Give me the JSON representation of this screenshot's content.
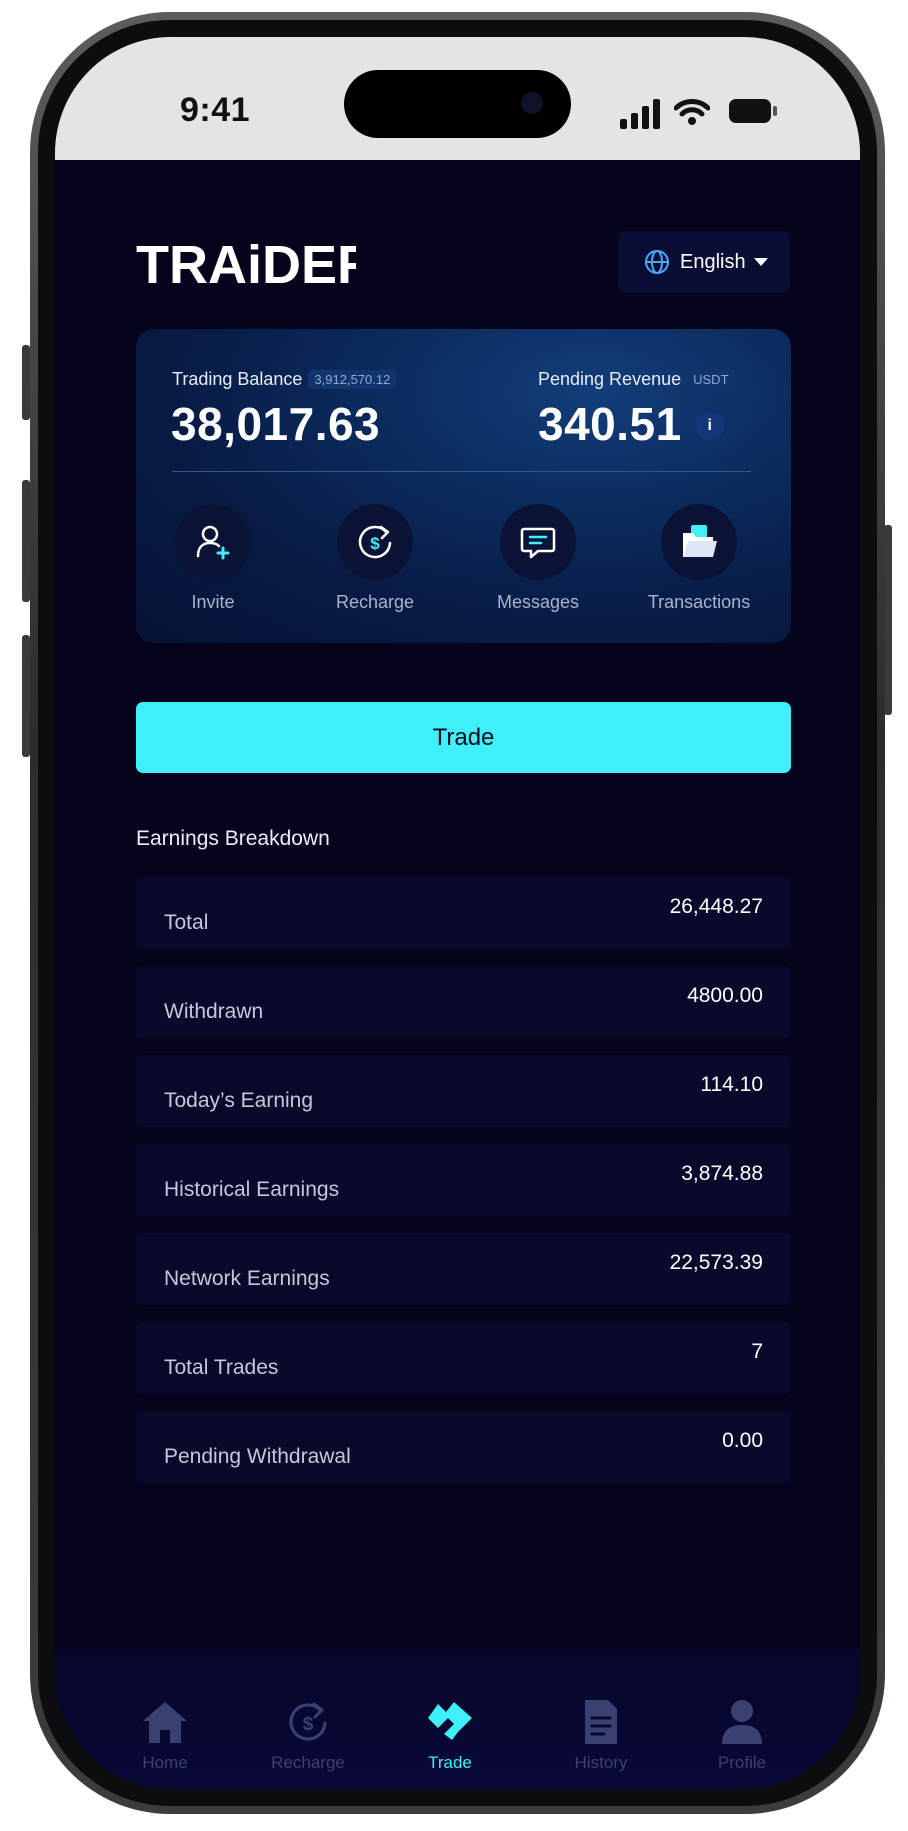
{
  "status_bar": {
    "time": "9:41"
  },
  "header": {
    "brand": "TRAiDER",
    "language": "English"
  },
  "balance_card": {
    "trading_balance_label": "Trading Balance",
    "trading_balance_tag": "3,912,570.12",
    "trading_balance_value": "38,017.63",
    "pending_revenue_label": "Pending Revenue",
    "pending_revenue_tag": "USDT",
    "pending_revenue_value": "340.51",
    "info_glyph": "i",
    "actions": [
      {
        "label": "Invite",
        "icon": "add-user-icon"
      },
      {
        "label": "Recharge",
        "icon": "recharge-icon"
      },
      {
        "label": "Messages",
        "icon": "message-icon"
      },
      {
        "label": "Transactions",
        "icon": "folder-icon"
      }
    ]
  },
  "trade_button": {
    "label": "Trade"
  },
  "earnings": {
    "title": "Earnings Breakdown",
    "rows": [
      {
        "label": "Total",
        "value": "26,448.27"
      },
      {
        "label": "Withdrawn",
        "value": "4800.00"
      },
      {
        "label": "Today’s Earning",
        "value": "114.10"
      },
      {
        "label": "Historical Earnings",
        "value": "3,874.88"
      },
      {
        "label": "Network Earnings",
        "value": "22,573.39"
      },
      {
        "label": "Total Trades",
        "value": "7"
      },
      {
        "label": "Pending Withdrawal",
        "value": "0.00"
      }
    ]
  },
  "tab_bar": {
    "active": "Trade",
    "items": [
      {
        "label": "Home",
        "icon": "home-icon"
      },
      {
        "label": "Recharge",
        "icon": "recharge-icon"
      },
      {
        "label": "Trade",
        "icon": "trade-icon"
      },
      {
        "label": "History",
        "icon": "document-icon"
      },
      {
        "label": "Profile",
        "icon": "user-icon"
      }
    ]
  },
  "colors": {
    "background": "#05041c",
    "accent": "#3ff0f9",
    "card": "#0b2a5c",
    "row": "#090a2b",
    "tab_inactive": "#3a4170"
  }
}
